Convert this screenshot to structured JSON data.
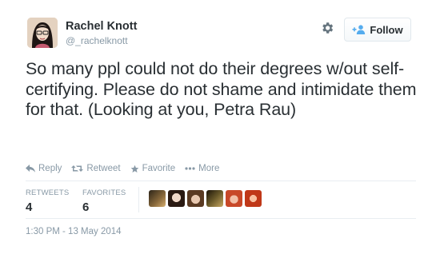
{
  "user": {
    "name": "Rachel Knott",
    "handle": "@_rachelknott"
  },
  "follow_button": {
    "label": "Follow"
  },
  "tweet": {
    "text": "So many ppl could not do their degrees w/out self-certifying. Please do not shame and intimidate them for that. (Looking at you, Petra Rau)"
  },
  "actions": {
    "reply": "Reply",
    "retweet": "Retweet",
    "favorite": "Favorite",
    "more": "More"
  },
  "stats": {
    "retweets_label": "RETWEETS",
    "retweets_value": "4",
    "favorites_label": "FAVORITES",
    "favorites_value": "6"
  },
  "timestamp": "1:30 PM - 13 May 2014",
  "colors": {
    "text": "#292f33",
    "muted": "#8899a6",
    "follow_icon": "#55acee",
    "divider": "#e8edf1"
  },
  "icons": {
    "settings": "gear-icon",
    "follow": "add-user-icon",
    "reply": "reply-arrow-icon",
    "retweet": "retweet-icon",
    "favorite": "star-icon",
    "more": "ellipsis-icon"
  }
}
